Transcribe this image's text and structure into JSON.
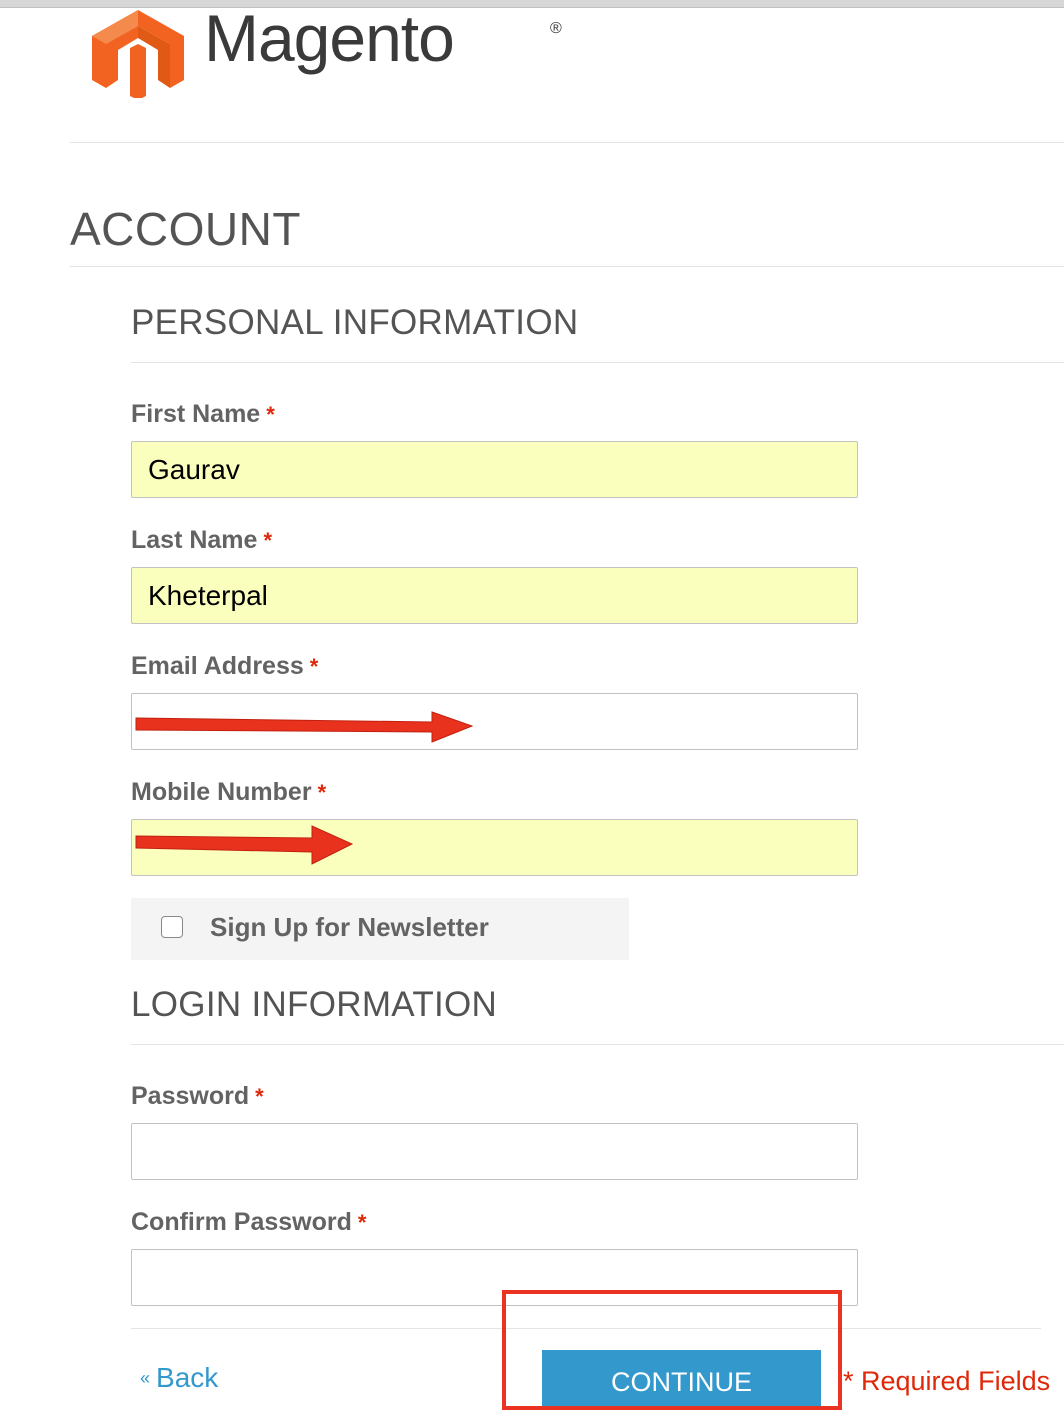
{
  "brand": {
    "name": "Magento",
    "registered_mark": "®",
    "colors": {
      "logo_orange": "#f26322",
      "logo_text": "#3a3a3a"
    }
  },
  "page": {
    "title": "ACCOUNT"
  },
  "personal_section": {
    "title": "PERSONAL INFORMATION",
    "first_name": {
      "label": "First Name",
      "required": "*",
      "value": "Gaurav"
    },
    "last_name": {
      "label": "Last Name",
      "required": "*",
      "value": "Kheterpal"
    },
    "email": {
      "label": "Email Address",
      "required": "*",
      "value": ""
    },
    "mobile": {
      "label": "Mobile Number",
      "required": "*",
      "value": ""
    },
    "newsletter": {
      "label": "Sign Up for Newsletter",
      "checked": false
    }
  },
  "login_section": {
    "title": "LOGIN INFORMATION",
    "password": {
      "label": "Password",
      "required": "*",
      "value": ""
    },
    "confirm_password": {
      "label": "Confirm Password",
      "required": "*",
      "value": ""
    }
  },
  "actions": {
    "back_arrow": "«",
    "back_label": "Back",
    "continue_label": "CONTINUE",
    "required_note": "* Required Fields"
  },
  "annotations": {
    "arrow_color": "#e8321e",
    "box_color": "#ea3323",
    "icons": [
      "arrow-right-icon",
      "arrow-right-icon",
      "highlight-box"
    ]
  },
  "colors": {
    "accent": "#3399cc",
    "required": "#df280a",
    "autofill": "#faffbd"
  }
}
